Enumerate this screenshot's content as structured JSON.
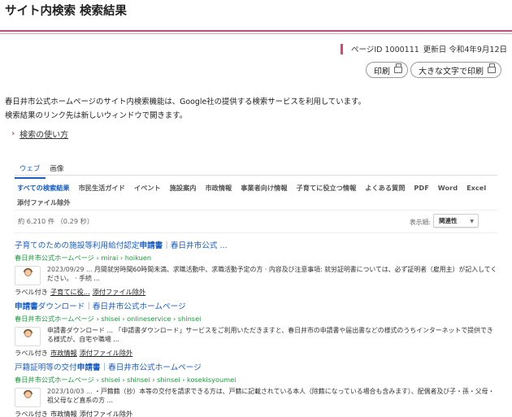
{
  "page": {
    "title": "サイト内検索 検索結果",
    "accent_color": "#d9437a",
    "link_color": "#1a5fc7",
    "url_color": "#199a3b"
  },
  "meta": {
    "page_id": "ページID 1000111",
    "updated": "更新日 令和4年9月12日"
  },
  "print_buttons": {
    "print": "印刷",
    "large_print": "大きな文字で印刷",
    "icon": "printer-icon"
  },
  "intro": {
    "line1": "春日井市公式ホームページのサイト内検索機能は、Google社の提供する検索サービスを利用しています。",
    "line2": "検索結果のリンク先は新しいウィンドウで開きます。",
    "howto_link": "検索の使い方"
  },
  "tabs": [
    "ウェブ",
    "画像"
  ],
  "refinements": [
    "すべての検索結果",
    "市民生活ガイド",
    "イベント",
    "施設案内",
    "市政情報",
    "事業者向け情報",
    "子育てに役立つ情報",
    "よくある質問",
    "PDF",
    "Word",
    "Excel",
    "添付ファイル除外"
  ],
  "results_info": {
    "count": "約 6,210 件 （0.29 秒）",
    "sort_label": "表示順:",
    "sort_value": "関連性"
  },
  "results": [
    {
      "title_pre": "子育てのための施設等利用給付認定",
      "title_bold": "申請書",
      "title_post": "｜春日井市公式 ...",
      "url": "春日井市公式ホームページ › mirai › hoikuen",
      "date": "2023/09/29 ...",
      "snippet": "月間就労時間60時間未満、求職活動中、求職活動予定の方 · 内容及び注意事項: 就労証明書については、必ず証明者（雇用主）が記入してください。 · 手続 ...",
      "label_prefix": "ラベル付き",
      "labels": [
        "子育てに役...",
        "添付ファイル除外"
      ]
    },
    {
      "title_pre": "",
      "title_bold": "申請書",
      "title_post": "ダウンロード｜春日井市公式ホームページ",
      "url": "春日井市公式ホームページ › shisei › onlineservice › shinsei",
      "date": "",
      "snippet": "申請書ダウンロード ... 「申請書ダウンロード」サービスをご利用いただきますと、春日井市の申請書や届出書などの様式のうちインターネットで提供できる様式が、自宅や職場 ...",
      "label_prefix": "ラベル付き",
      "labels": [
        "市政情報",
        "添付ファイル除外"
      ]
    },
    {
      "title_pre": "戸籍証明等の交付",
      "title_bold": "申請書",
      "title_post": "｜春日井市公式ホームページ",
      "url": "春日井市公式ホームページ › shisei › shinsei › shinsei › kosekisyoumei",
      "date": "2023/10/03 ...",
      "snippet": "・戸籍籍（抄）本等の交付を請求できる方は、戸籍に記載されている本人（除籍になっている場合も含みます）、配偶者及び子・孫・父母・祖父母など直系の方 ...",
      "label_prefix": "ラベル付き",
      "labels": [
        "市政情報",
        "添付ファイル除外"
      ]
    }
  ]
}
